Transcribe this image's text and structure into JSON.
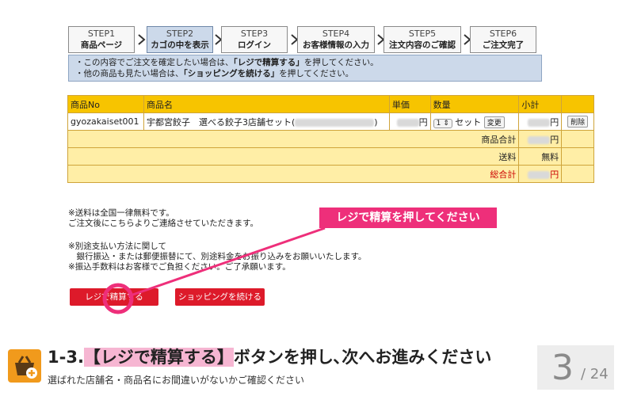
{
  "steps": [
    {
      "num": "STEP1",
      "label": "商品ページ"
    },
    {
      "num": "STEP2",
      "label": "カゴの中を表示"
    },
    {
      "num": "STEP3",
      "label": "ログイン"
    },
    {
      "num": "STEP4",
      "label": "お客様情報の入力"
    },
    {
      "num": "STEP5",
      "label": "注文内容のご確認"
    },
    {
      "num": "STEP6",
      "label": "ご注文完了"
    }
  ],
  "info": {
    "line1_pre": "・この内容でご注文を確定したい場合は、",
    "line1_bold": "「レジで精算する」",
    "line1_post": "を押してください。",
    "line2_pre": "・他の商品も見たい場合は、",
    "line2_bold": "「ショッピングを続ける」",
    "line2_post": "を押してください。"
  },
  "table": {
    "headers": {
      "no": "商品No",
      "name": "商品名",
      "price": "単価",
      "qty": "数量",
      "subtotal": "小計"
    },
    "row": {
      "no": "gyozakaiset001",
      "name": "宇都宮餃子　選べる餃子3店舗セット(",
      "name_end": ")",
      "yen": "円",
      "qty": "1",
      "set": "セット",
      "change": "変更",
      "delete": "削除"
    },
    "summary": {
      "goods_total": "商品合計",
      "shipping": "送料",
      "shipping_value": "無料",
      "grand_total": "総合計",
      "yen": "円"
    }
  },
  "notes": {
    "n1": "※送料は全国一律無料です。",
    "n2": "ご注文後にこちらよりご連絡させていただきます。",
    "n3": "※別途支払い方法に関して",
    "n4": "　銀行振込・または郵便振替にて、別途料金をお振り込みをお願いいたします。",
    "n5": "※振込手数料はお客様でご負担ください。ご了承願います。"
  },
  "buttons": {
    "checkout": "レジで精算する",
    "continue": "ショッピングを続ける"
  },
  "callout": "レジで精算を押してください",
  "bottom": {
    "title_pre": "1-3.",
    "title_hl": "【レジで精算する】",
    "title_post": "ボタンを押し､次へお進みください",
    "subtitle": "選ばれた店舗名・商品名にお間違いがないかご確認ください",
    "page": "3",
    "total": "/ 24"
  },
  "colors": {
    "callout": "#ee2f7a",
    "header": "#f7c400",
    "summary": "#ffeea6",
    "button": "#dd1a2a",
    "highlight": "#f6b6d2"
  }
}
